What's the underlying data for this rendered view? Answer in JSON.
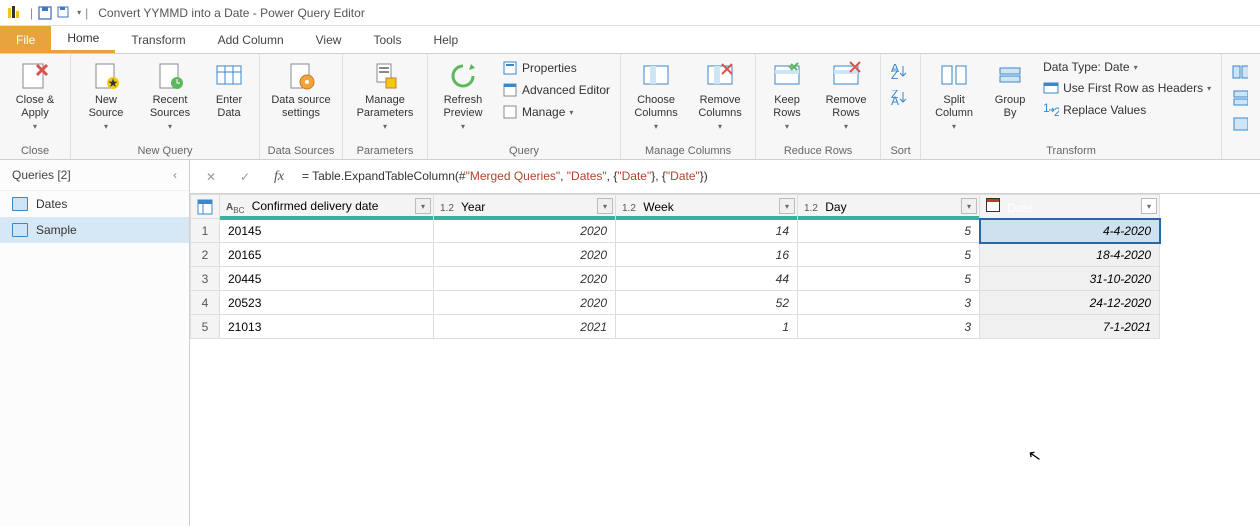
{
  "window": {
    "title": "Convert YYMMD into a Date - Power Query Editor",
    "qat_sep": "|",
    "dd": "▾"
  },
  "tabs": {
    "file": "File",
    "home": "Home",
    "transform": "Transform",
    "add_column": "Add Column",
    "view": "View",
    "tools": "Tools",
    "help": "Help"
  },
  "ribbon": {
    "close": {
      "close_apply": "Close &\nApply",
      "group": "Close"
    },
    "new_query": {
      "new_source": "New\nSource",
      "recent_sources": "Recent\nSources",
      "enter_data": "Enter\nData",
      "group": "New Query"
    },
    "data_sources": {
      "settings": "Data source\nsettings",
      "group": "Data Sources"
    },
    "parameters": {
      "manage": "Manage\nParameters",
      "group": "Parameters"
    },
    "query": {
      "refresh": "Refresh\nPreview",
      "properties": "Properties",
      "advanced": "Advanced Editor",
      "manage": "Manage",
      "group": "Query"
    },
    "manage_cols": {
      "choose": "Choose\nColumns",
      "remove": "Remove\nColumns",
      "group": "Manage Columns"
    },
    "reduce": {
      "keep": "Keep\nRows",
      "remove": "Remove\nRows",
      "group": "Reduce Rows"
    },
    "sort": {
      "group": "Sort"
    },
    "transform": {
      "split": "Split\nColumn",
      "group_by": "Group\nBy",
      "data_type": "Data Type: Date",
      "first_row": "Use First Row as Headers",
      "replace": "Replace Values",
      "group": "Transform"
    }
  },
  "queries": {
    "header": "Queries [2]",
    "collapse": "‹",
    "items": [
      {
        "label": "Dates"
      },
      {
        "label": "Sample"
      }
    ],
    "selected_index": 1
  },
  "formula": {
    "cancel": "✕",
    "confirm": "✓",
    "fx": "fx",
    "pre": "= Table.ExpandTableColumn(#",
    "s1": "\"Merged Queries\"",
    "c1": ", ",
    "s2": "\"Dates\"",
    "c2": ", {",
    "s3": "\"Date\"",
    "c3": "}, {",
    "s4": "\"Date\"",
    "c4": "})"
  },
  "table": {
    "columns": {
      "confirmed": "Confirmed delivery date",
      "year": "Year",
      "week": "Week",
      "day": "Day",
      "date": "Date"
    },
    "rows": [
      {
        "n": "1",
        "confirmed": "20145",
        "year": "2020",
        "week": "14",
        "day": "5",
        "date": "4-4-2020"
      },
      {
        "n": "2",
        "confirmed": "20165",
        "year": "2020",
        "week": "16",
        "day": "5",
        "date": "18-4-2020"
      },
      {
        "n": "3",
        "confirmed": "20445",
        "year": "2020",
        "week": "44",
        "day": "5",
        "date": "31-10-2020"
      },
      {
        "n": "4",
        "confirmed": "20523",
        "year": "2020",
        "week": "52",
        "day": "3",
        "date": "24-12-2020"
      },
      {
        "n": "5",
        "confirmed": "21013",
        "year": "2021",
        "week": "1",
        "day": "3",
        "date": "7-1-2021"
      }
    ],
    "selected_row": 0
  }
}
